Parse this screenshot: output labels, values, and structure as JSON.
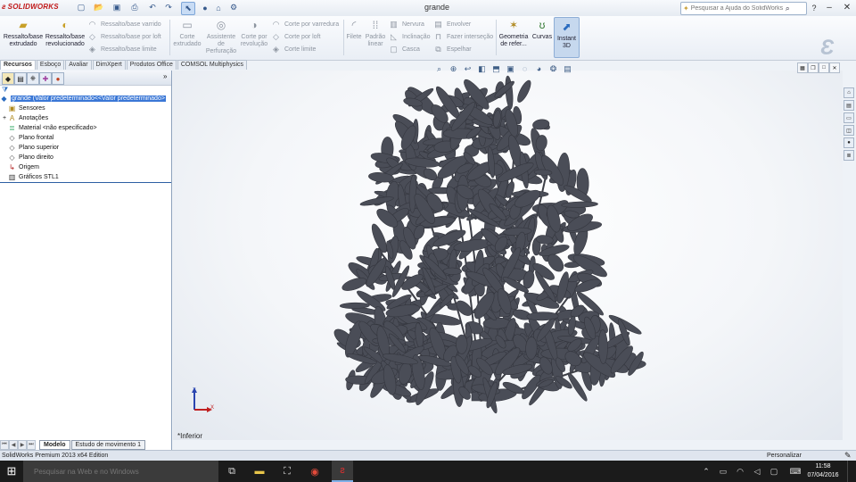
{
  "app": {
    "brand": "SOLIDWORKS",
    "document_title": "grande",
    "help_search_placeholder": "Pesquisar a Ajuda do SolidWorks"
  },
  "ribbon": {
    "big_buttons": [
      {
        "label": "Ressalto/base extrudado",
        "icon": "boss-extrude-icon"
      },
      {
        "label": "Ressalto/base revolucionado",
        "icon": "boss-revolve-icon"
      },
      {
        "label": "Corte extrudado",
        "icon": "cut-extrude-icon"
      },
      {
        "label": "Assistente de Perfuração",
        "icon": "hole-wizard-icon"
      },
      {
        "label": "Corte por revolução",
        "icon": "cut-revolve-icon"
      },
      {
        "label": "Filete",
        "icon": "fillet-icon"
      },
      {
        "label": "Padrão linear",
        "icon": "linear-pattern-icon"
      },
      {
        "label": "Geometria de refer...",
        "icon": "reference-geometry-icon"
      },
      {
        "label": "Curvas",
        "icon": "curves-icon"
      },
      {
        "label": "Instant 3D",
        "icon": "instant3d-icon"
      }
    ],
    "small_col1": [
      "Ressalto/base varrido",
      "Ressalto/base por loft",
      "Ressalto/base limite"
    ],
    "small_col2": [
      "Corte por varredura",
      "Corte por loft",
      "Corte limite"
    ],
    "small_col3": [
      "Nervura",
      "Inclinação",
      "Casca"
    ],
    "small_col4": [
      "Envolver",
      "Fazer interseção",
      "Espelhar"
    ]
  },
  "command_tabs": [
    "Recursos",
    "Esboço",
    "Avaliar",
    "DimXpert",
    "Produtos Office",
    "COMSOL Multiphysics"
  ],
  "feature_tree": {
    "root": "grande  (Valor predeterminado<<Valor predeterminado>",
    "items": [
      "Sensores",
      "Anotações",
      "Material <não especificado>",
      "Plano frontal",
      "Plano superior",
      "Plano direito",
      "Origem",
      "Gráficos STL1"
    ]
  },
  "bottom_tabs": [
    "Modelo",
    "Estudo de movimento 1"
  ],
  "viewport": {
    "view_label": "*Inferior",
    "triad_x": "X",
    "triad_z": "Z",
    "model_color": "#4a4d57"
  },
  "status": {
    "left": "SolidWorks Premium 2013 x64 Edition",
    "right": "Personalizar"
  },
  "taskbar": {
    "search_placeholder": "Pesquisar na Web e no Windows",
    "time": "11:58",
    "date": "07/04/2016"
  }
}
